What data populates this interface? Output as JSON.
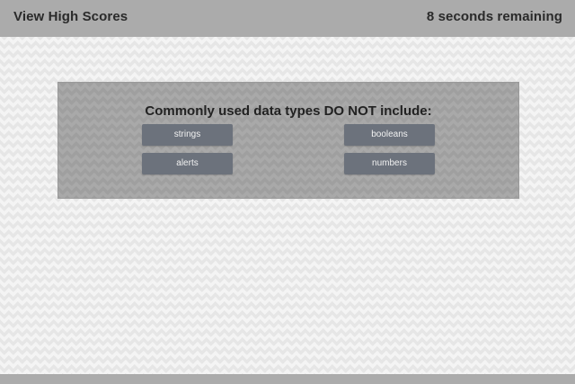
{
  "header": {
    "high_scores_link": "View High Scores",
    "timer_text": "8 seconds remaining"
  },
  "quiz": {
    "question": "Commonly used data types DO NOT include:",
    "answers": [
      {
        "label": "strings"
      },
      {
        "label": "booleans"
      },
      {
        "label": "alerts"
      },
      {
        "label": "numbers"
      }
    ]
  },
  "colors": {
    "header_background": "#ababab",
    "card_background": "#a9a9a9",
    "button_background": "#6c727c",
    "button_text": "#f2f2f2",
    "page_background": "#f4f4f4"
  }
}
